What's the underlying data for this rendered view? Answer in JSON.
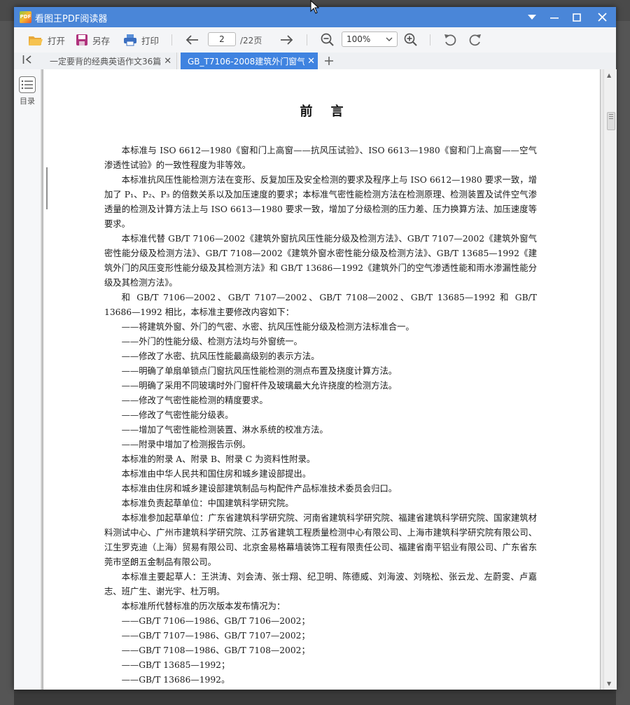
{
  "window": {
    "app_logo_text": "PDF",
    "title": "看图王PDF阅读器"
  },
  "toolbar": {
    "open_label": "打开",
    "save_as_label": "另存",
    "print_label": "打印",
    "current_page": "2",
    "total_pages": "/22页",
    "zoom_value": "100%"
  },
  "tabs": [
    {
      "label": "一定要背的经典英语作文36篇",
      "active": false
    },
    {
      "label": "GB_T7106-2008建筑外门窗气",
      "active": true
    }
  ],
  "sidebar": {
    "toc_label": "目录"
  },
  "document": {
    "heading": "前言",
    "paragraphs": [
      {
        "type": "para",
        "text": "本标准与 ISO 6612—1980《窗和门上高窗——抗风压试验》、ISO 6613—1980《窗和门上高窗——空气渗透性试验》的一致性程度为非等效。"
      },
      {
        "type": "para",
        "text": "本标准抗风压性能检测方法在变形、反复加压及安全检测的要求及程序上与 ISO 6612—1980 要求一致，增加了 P₁、P₂、P₃ 的倍数关系以及加压速度的要求；本标准气密性能检测方法在检测原理、检测装置及试件空气渗透量的检测及计算方法上与 ISO 6613—1980 要求一致，增加了分级检测的压力差、压力换算方法、加压速度等要求。"
      },
      {
        "type": "para",
        "text": "本标准代替 GB/T 7106—2002《建筑外窗抗风压性能分级及检测方法》、GB/T 7107—2002《建筑外窗气密性能分级及检测方法》、GB/T 7108—2002《建筑外窗水密性能分级及检测方法》、GB/T 13685—1992《建筑外门的风压变形性能分级及其检测方法》和 GB/T 13686—1992《建筑外门的空气渗透性能和雨水渗漏性能分级及其检测方法》。"
      },
      {
        "type": "para",
        "text": "和 GB/T 7106—2002、GB/T 7107—2002、GB/T 7108—2002、GB/T 13685—1992 和 GB/T 13686—1992 相比，本标准主要修改内容如下："
      },
      {
        "type": "item",
        "text": "——将建筑外窗、外门的气密、水密、抗风压性能分级及检测方法标准合一。"
      },
      {
        "type": "item",
        "text": "——外门的性能分级、检测方法均与外窗统一。"
      },
      {
        "type": "item",
        "text": "——修改了水密、抗风压性能最高级别的表示方法。"
      },
      {
        "type": "item",
        "text": "——明确了单扇单锁点门窗抗风压性能检测的测点布置及挠度计算方法。"
      },
      {
        "type": "item",
        "text": "——明确了采用不同玻璃时外门窗杆件及玻璃最大允许挠度的检测方法。"
      },
      {
        "type": "item",
        "text": "——修改了气密性能检测的精度要求。"
      },
      {
        "type": "item",
        "text": "——修改了气密性能分级表。"
      },
      {
        "type": "item",
        "text": "——增加了气密性能检测装置、淋水系统的校准方法。"
      },
      {
        "type": "item",
        "text": "——附录中增加了检测报告示例。"
      },
      {
        "type": "para",
        "text": "本标准的附录 A、附录 B、附录 C 为资料性附录。"
      },
      {
        "type": "para",
        "text": "本标准由中华人民共和国住房和城乡建设部提出。"
      },
      {
        "type": "para",
        "text": "本标准由住房和城乡建设部建筑制品与构配件产品标准技术委员会归口。"
      },
      {
        "type": "para",
        "text": "本标准负责起草单位：中国建筑科学研究院。"
      },
      {
        "type": "para",
        "text": "本标准参加起草单位：广东省建筑科学研究院、河南省建筑科学研究院、福建省建筑科学研究院、国家建筑材料测试中心、广州市建筑科学研究院、江苏省建筑工程质量检测中心有限公司、上海市建筑科学研究院有限公司、江生罗克迪（上海）贸易有限公司、北京金易格幕墙装饰工程有限责任公司、福建省南平铝业有限公司、广东省东莞市坚朗五金制品有限公司。"
      },
      {
        "type": "para",
        "text": "本标准主要起草人：王洪涛、刘会涛、张士翔、纪卫明、陈德威、刘海波、刘晓松、张云龙、左蔚雯、卢嘉志、班广生、谢光宇、杜万明。"
      },
      {
        "type": "para",
        "text": "本标准所代替标准的历次版本发布情况为："
      },
      {
        "type": "item",
        "text": "——GB/T 7106—1986、GB/T 7106—2002；"
      },
      {
        "type": "item",
        "text": "——GB/T 7107—1986、GB/T 7107—2002；"
      },
      {
        "type": "item",
        "text": "——GB/T 7108—1986、GB/T 7108—2002；"
      },
      {
        "type": "item",
        "text": "——GB/T 13685—1992；"
      },
      {
        "type": "item",
        "text": "——GB/T 13686—1992。"
      }
    ]
  },
  "colors": {
    "titlebar": "#4a86d8",
    "active_tab": "#3f83e0"
  }
}
